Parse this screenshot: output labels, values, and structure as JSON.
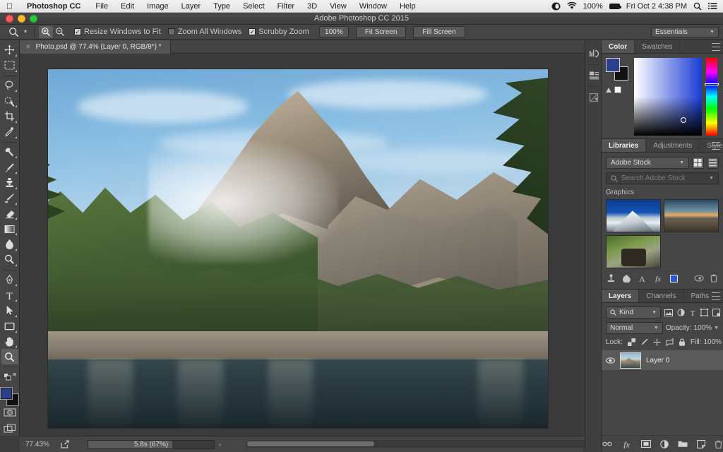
{
  "macbar": {
    "apple_icon": "apple-logo-icon",
    "app_name": "Photoshop CC",
    "menus": [
      "File",
      "Edit",
      "Image",
      "Layer",
      "Type",
      "Select",
      "Filter",
      "3D",
      "View",
      "Window",
      "Help"
    ],
    "battery_percent": "100%",
    "datetime": "Fri Oct 2  4:38 PM",
    "status_icons": [
      "dropbox-icon",
      "wifi-icon",
      "battery-icon",
      "spotlight-search-icon",
      "notification-center-icon"
    ]
  },
  "titlebar": {
    "title": "Adobe Photoshop CC 2015",
    "buttons": [
      "close-button",
      "minimize-button",
      "zoom-button"
    ]
  },
  "options_bar": {
    "tool_icon": "zoom-tool-icon",
    "zoom_in_label": "zoom-in-icon",
    "zoom_out_label": "zoom-out-icon",
    "resize_windows": {
      "label": "Resize Windows to Fit",
      "checked": true
    },
    "zoom_all_windows": {
      "label": "Zoom All Windows",
      "checked": false
    },
    "scrubby_zoom": {
      "label": "Scrubby Zoom",
      "checked": true
    },
    "zoom_value": "100%",
    "fit_screen": "Fit Screen",
    "fill_screen": "Fill Screen",
    "workspace": "Essentials"
  },
  "document": {
    "tab_label": "Photo.psd @ 77.4% (Layer 0, RGB/8*) *",
    "close_icon": "close-tab-icon"
  },
  "toolbox": {
    "groups": [
      [
        "move-tool",
        "marquee-tool"
      ],
      [
        "lasso-tool",
        "quick-selection-tool",
        "crop-tool",
        "eyedropper-tool"
      ],
      [
        "spot-healing-tool",
        "brush-tool",
        "clone-stamp-tool",
        "history-brush-tool",
        "eraser-tool",
        "gradient-tool",
        "blur-tool",
        "dodge-tool"
      ],
      [
        "pen-tool",
        "type-tool",
        "path-selection-tool",
        "rectangle-tool"
      ],
      [
        "hand-tool",
        "zoom-tool"
      ]
    ],
    "active_tool": "zoom-tool",
    "foreground_color": "#2b3f8c",
    "background_color": "#111111",
    "quick_mask_icon": "quick-mask-icon",
    "screen_mode_icon": "screen-mode-icon"
  },
  "status_bar": {
    "zoom": "77.43%",
    "share_icon": "share-icon",
    "progress_label": "5.8s (67%)",
    "progress_percent": 67,
    "arrow": "›"
  },
  "collapsed_rail": {
    "items": [
      "histogram-icon",
      "properties-icon",
      "brush-presets-icon"
    ]
  },
  "color_panel": {
    "tabs": [
      {
        "label": "Color",
        "active": true
      },
      {
        "label": "Swatches",
        "active": false
      }
    ],
    "menu_icon": "panel-menu-icon",
    "foreground_color": "#2b3f8c",
    "background_color": "#111111",
    "out_of_gamut_icon": "gamut-warning-icon",
    "white_swatch_icon": "white-swatch-icon"
  },
  "libraries_panel": {
    "tabs": [
      {
        "label": "Libraries",
        "active": true
      },
      {
        "label": "Adjustments",
        "active": false
      },
      {
        "label": "Styles",
        "active": false
      }
    ],
    "menu_icon": "panel-menu-icon",
    "source": "Adobe Stock",
    "grid_view_icon": "grid-view-icon",
    "list_view_icon": "list-view-icon",
    "search_placeholder": "Search Adobe Stock",
    "search_icon": "search-icon",
    "section_label": "Graphics",
    "thumbnails": [
      "snow-mountain-thumbnail",
      "lake-sunset-thumbnail",
      "forest-rock-thumbnail"
    ],
    "footer_icons": [
      "add-content-icon",
      "color-theme-icon",
      "character-style-icon",
      "layer-style-icon",
      "color-swatch-icon",
      "sync-icon",
      "delete-icon"
    ]
  },
  "layers_panel": {
    "tabs": [
      {
        "label": "Layers",
        "active": true
      },
      {
        "label": "Channels",
        "active": false
      },
      {
        "label": "Paths",
        "active": false
      }
    ],
    "menu_icon": "panel-menu-icon",
    "filter_kind": "Kind",
    "filter_icons": [
      "filter-pixel-icon",
      "filter-adjustment-icon",
      "filter-type-icon",
      "filter-shape-icon",
      "filter-smart-object-icon",
      "filter-toggle-icon"
    ],
    "blend_mode": "Normal",
    "opacity_label": "Opacity:",
    "opacity_value": "100%",
    "lock_label": "Lock:",
    "lock_icons": [
      "lock-transparent-pixels-icon",
      "lock-image-pixels-icon",
      "lock-position-icon",
      "lock-artboard-icon",
      "lock-all-icon"
    ],
    "fill_label": "Fill:",
    "fill_value": "100%",
    "layers": [
      {
        "name": "Layer 0",
        "visible": true,
        "selected": true
      }
    ],
    "footer_icons": [
      "link-layers-icon",
      "add-layer-style-icon",
      "add-layer-mask-icon",
      "new-adjustment-layer-icon",
      "new-group-icon",
      "new-layer-icon",
      "delete-layer-icon"
    ]
  },
  "canvas": {
    "image_description": "mountain-lake-photo",
    "scroll_icon": "horizontal-scrollbar"
  }
}
